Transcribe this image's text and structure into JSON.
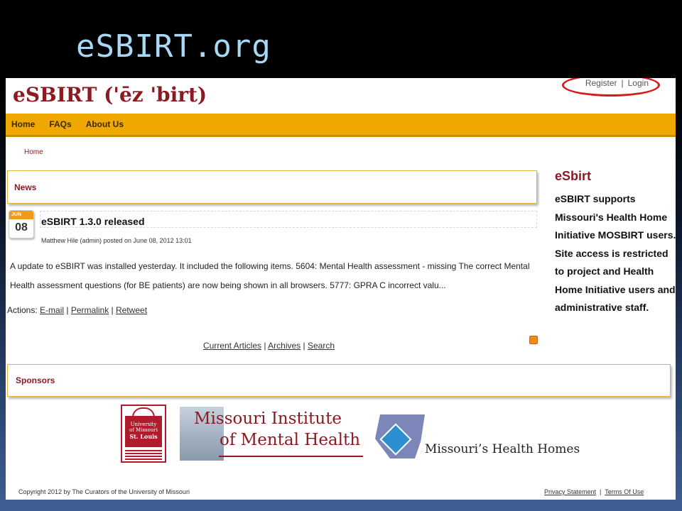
{
  "slide": {
    "title": "eSBIRT.org"
  },
  "header": {
    "logo": "eSBIRT ('ēz 'birt)",
    "register": "Register",
    "separator": "|",
    "login": "Login"
  },
  "nav": {
    "items": [
      "Home",
      "FAQs",
      "About Us"
    ]
  },
  "breadcrumb": "Home",
  "news": {
    "panel_title": "News",
    "calendar_month": "JUN",
    "calendar_day": "08",
    "article_title": "eSBIRT 1.3.0 released",
    "byline": "Matthew Hile (admin) posted on June 08, 2012 13:01",
    "body": "A update to eSBIRT was installed yesterday. It included the following items. 5604: Mental Health assessment - missing The correct Mental Health assessment questions (for BE patients) are now being shown in all browsers. 5777: GPRA C incorrect valu...",
    "actions_label": "Actions:",
    "actions": [
      "E-mail",
      "Permalink",
      "Retweet"
    ],
    "bottom_links": [
      "Current Articles",
      "Archives",
      "Search"
    ]
  },
  "sidebar": {
    "title": "eSbirt",
    "text": "eSBIRT supports Missouri's Health Home Initiative MOSBIRT users. Site access is restricted to project and Health Home Initiative users and administrative staff."
  },
  "sponsors": {
    "panel_title": "Sponsors",
    "umsl_lines": [
      "University",
      "of Missouri",
      "St. Louis"
    ],
    "mimh_line1": "Missouri Institute",
    "mimh_line2": "of Mental Health",
    "mhh": "Missouri’s Health Homes"
  },
  "footer": {
    "copyright": "Copyright 2012 by The Curators of the University of Missouri",
    "privacy": "Privacy Statement",
    "terms": "Terms Of Use"
  },
  "colors": {
    "accent": "#efa800",
    "brand": "#8b1a22",
    "highlight_ring": "#d61a1a"
  }
}
